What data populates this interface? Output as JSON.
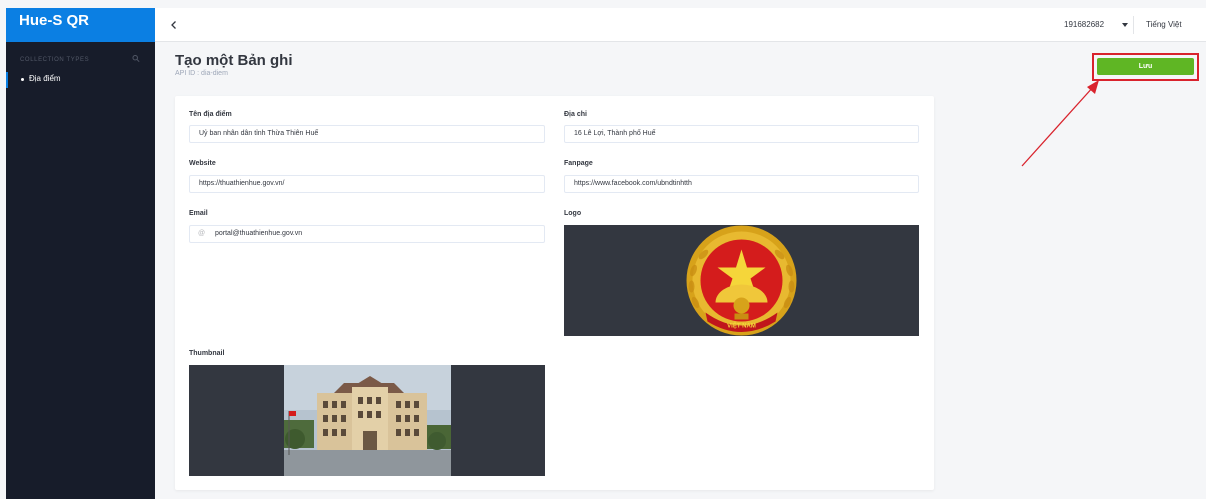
{
  "app": {
    "brand": "Hue-S QR"
  },
  "sidebar": {
    "section_title": "COLLECTION TYPES",
    "items": [
      {
        "label": "Địa điểm"
      }
    ]
  },
  "header": {
    "user": "191682682",
    "language": "Tiếng Việt"
  },
  "page": {
    "title": "Tạo một Bản ghi",
    "api_id": "API ID : dia-diem",
    "save_label": "Lưu"
  },
  "form": {
    "ten_dia_diem": {
      "label": "Tên địa điểm",
      "value": "Uỷ ban nhân dân tỉnh Thừa Thiên Huế"
    },
    "dia_chi": {
      "label": "Địa chỉ",
      "value": "16 Lê Lợi, Thành phố Huế"
    },
    "website": {
      "label": "Website",
      "value": "https://thuathienhue.gov.vn/"
    },
    "fanpage": {
      "label": "Fanpage",
      "value": "https://www.facebook.com/ubndtinhtth"
    },
    "email": {
      "label": "Email",
      "icon": "@",
      "value": "portal@thuathienhue.gov.vn"
    },
    "logo": {
      "label": "Logo",
      "emblem_text": "VIỆT NAM"
    },
    "thumbnail": {
      "label": "Thumbnail"
    }
  },
  "colors": {
    "brand": "#0b7fe3",
    "sidebar": "#171c2a",
    "save": "#5fb624",
    "highlight": "#d9232d"
  },
  "icons": [
    "chevron-left-icon",
    "search-icon",
    "caret-down-icon"
  ]
}
